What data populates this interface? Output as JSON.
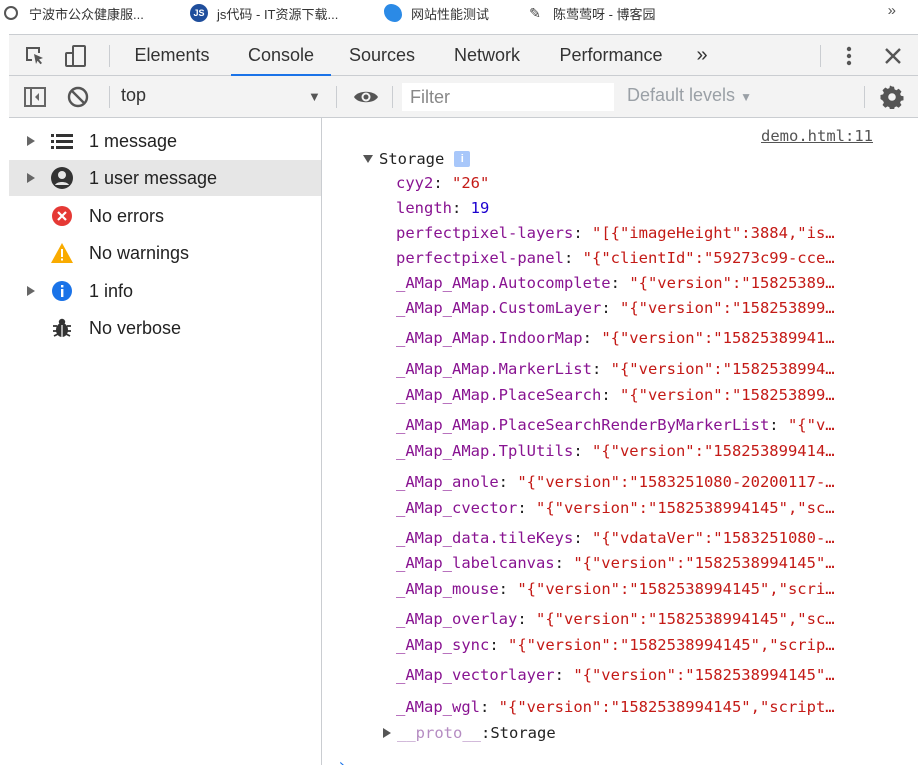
{
  "bookmarks": [
    {
      "label": "宁波市公众健康服...",
      "icon": "globe-icon",
      "icon_text": "",
      "color": "#555555"
    },
    {
      "label": "js代码 - IT资源下载...",
      "icon": "js-icon",
      "icon_text": "JS",
      "color": "#1f4e9c"
    },
    {
      "label": "网站性能测试",
      "icon": "swirl-icon",
      "icon_text": "",
      "color": "#2b8ae6"
    },
    {
      "label": "陈莺莺呀 - 博客园",
      "icon": "blog-icon",
      "icon_text": "",
      "color": "#444444"
    }
  ],
  "bookmarks_more": "»",
  "devtools": {
    "tabs": [
      "Elements",
      "Console",
      "Sources",
      "Network",
      "Performance"
    ],
    "active_tab": "Console",
    "more_tabs": "»"
  },
  "console_toolbar": {
    "context": "top",
    "filter_placeholder": "Filter",
    "levels": "Default levels"
  },
  "sidebar": {
    "items": [
      {
        "label": "1 message",
        "icon": "list-icon"
      },
      {
        "label": "1 user message",
        "icon": "user-icon"
      },
      {
        "label": "No errors",
        "icon": "error-icon"
      },
      {
        "label": "No warnings",
        "icon": "warning-icon"
      },
      {
        "label": "1 info",
        "icon": "info-icon"
      },
      {
        "label": "No verbose",
        "icon": "bug-icon"
      }
    ]
  },
  "output": {
    "source_link": "demo.html:11",
    "object_name": "Storage",
    "info_badge": "i",
    "entries": [
      {
        "key": "cyy2",
        "value": "\"26\""
      },
      {
        "key": "length",
        "value": "19"
      },
      {
        "key": "perfectpixel-layers",
        "value": "\"[{\"imageHeight\":3884,\"is…"
      },
      {
        "key": "perfectpixel-panel",
        "value": "\"{\"clientId\":\"59273c99-cce…"
      },
      {
        "key": "_AMap_AMap.Autocomplete",
        "value": "\"{\"version\":\"15825389…"
      },
      {
        "key": "_AMap_AMap.CustomLayer",
        "value": "\"{\"version\":\"158253899…"
      },
      {
        "key": "_AMap_AMap.IndoorMap",
        "value": "\"{\"version\":\"15825389941…"
      },
      {
        "key": "_AMap_AMap.MarkerList",
        "value": "\"{\"version\":\"158253899​4…"
      },
      {
        "key": "_AMap_AMap.PlaceSearch",
        "value": "\"{\"version\":\"158253899…"
      },
      {
        "key": "_AMap_AMap.PlaceSearchRenderByMarkerList",
        "value": "\"{\"v…"
      },
      {
        "key": "_AMap_AMap.TplUtils",
        "value": "\"{\"version\":\"158253899414…"
      },
      {
        "key": "_AMap_anole",
        "value": "\"{\"version\":\"1583251080-20200117-…"
      },
      {
        "key": "_AMap_cvector",
        "value": "\"{\"version\":\"1582538994145\",\"sc…"
      },
      {
        "key": "_AMap_data.tileKeys",
        "value": "\"{\"vdataVer\":\"1583251080-…"
      },
      {
        "key": "_AMap_labelcanvas",
        "value": "\"{\"version\":\"1582538994145\"…"
      },
      {
        "key": "_AMap_mouse",
        "value": "\"{\"version\":\"1582538994145\",\"scri…"
      },
      {
        "key": "_AMap_overlay",
        "value": "\"{\"version\":\"1582538994145\",\"sc…"
      },
      {
        "key": "_AMap_sync",
        "value": "\"{\"version\":\"1582538994145\",\"scrip…"
      },
      {
        "key": "_AMap_vectorlayer",
        "value": "\"{\"version\":\"1582538994145\"…"
      },
      {
        "key": "_AMap_wgl",
        "value": "\"{\"version\":\"1582538994145\",\"script…"
      }
    ],
    "proto_key": "__proto__",
    "proto_value": "Storage",
    "prompt": "›"
  }
}
